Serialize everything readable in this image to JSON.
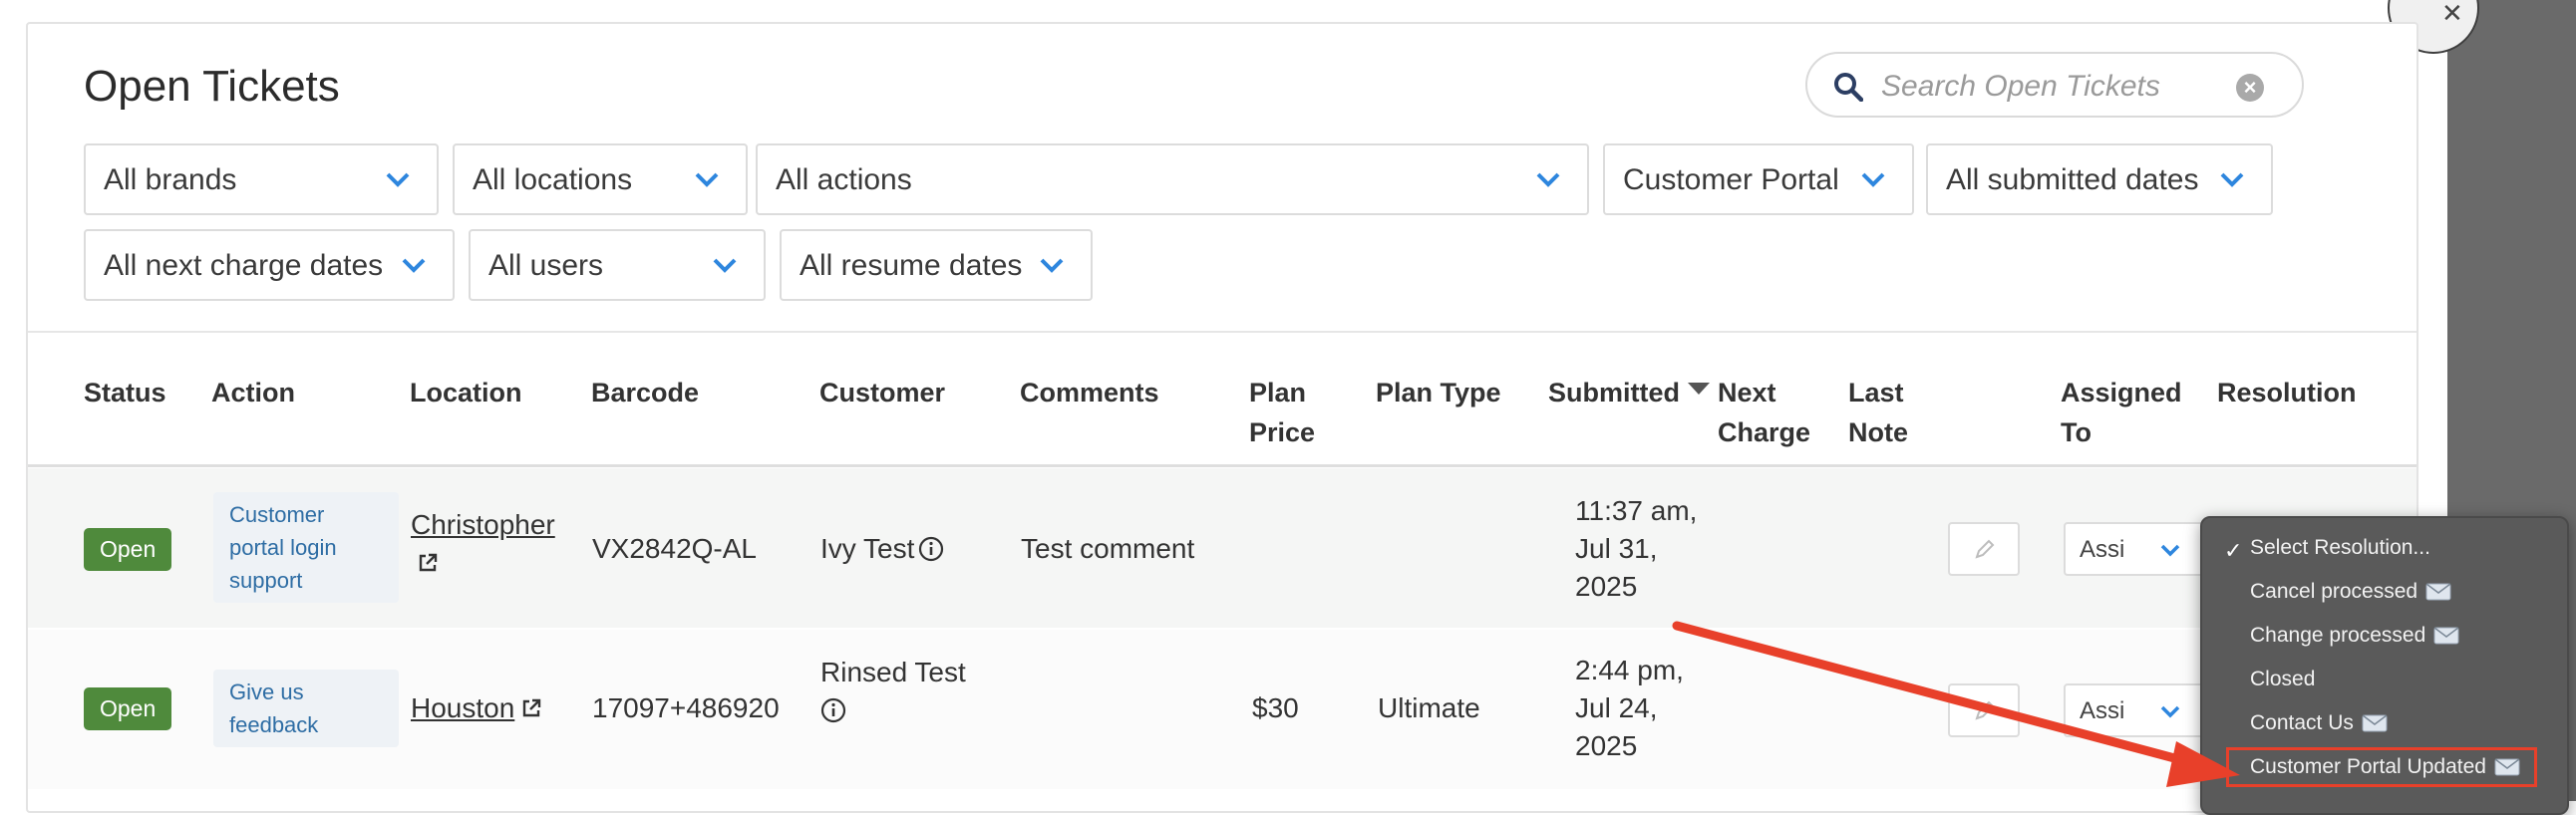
{
  "page": {
    "title": "Open Tickets",
    "search_placeholder": "Search Open Tickets"
  },
  "filters": [
    {
      "label": "All brands"
    },
    {
      "label": "All locations"
    },
    {
      "label": "All actions"
    },
    {
      "label": "Customer Portal"
    },
    {
      "label": "All submitted dates"
    },
    {
      "label": "All next charge dates"
    },
    {
      "label": "All users"
    },
    {
      "label": "All resume dates"
    }
  ],
  "table": {
    "headers": {
      "status": "Status",
      "action": "Action",
      "location": "Location",
      "barcode": "Barcode",
      "customer": "Customer",
      "comments": "Comments",
      "plan_price_1": "Plan",
      "plan_price_2": "Price",
      "plan_type": "Plan Type",
      "submitted": "Submitted",
      "next_charge_1": "Next",
      "next_charge_2": "Charge",
      "last_note_1": "Last",
      "last_note_2": "Note",
      "assigned_1": "Assigned",
      "assigned_2": "To",
      "resolution": "Resolution"
    },
    "rows": [
      {
        "status": "Open",
        "action_1": "Customer",
        "action_2": "portal login",
        "action_3": "support",
        "location": "Christopher",
        "barcode": "VX2842Q-AL",
        "customer": "Ivy Test",
        "comments": "Test comment",
        "plan_price": "",
        "plan_type": "",
        "submitted_1": "11:37 am,",
        "submitted_2": "Jul 31,",
        "submitted_3": "2025",
        "assigned": "Assign"
      },
      {
        "status": "Open",
        "action_1": "Give us",
        "action_2": "feedback",
        "location": "Houston",
        "barcode": "17097+486920",
        "customer_1": "Rinsed Test",
        "comments": "",
        "plan_price": "$30",
        "plan_type": "Ultimate",
        "submitted_1": "2:44 pm,",
        "submitted_2": "Jul 24,",
        "submitted_3": "2025",
        "assigned": "Assign"
      }
    ]
  },
  "resolution_dropdown": {
    "items": [
      {
        "label": "Select Resolution...",
        "selected": true,
        "email_icon": false
      },
      {
        "label": "Cancel processed",
        "email_icon": true
      },
      {
        "label": "Change processed",
        "email_icon": true
      },
      {
        "label": "Closed",
        "email_icon": false
      },
      {
        "label": "Contact Us",
        "email_icon": true
      },
      {
        "label": "Customer Portal Updated",
        "email_icon": true,
        "highlighted": true
      }
    ]
  },
  "colors": {
    "accent_blue": "#2e86de",
    "status_open": "#4f8a3c",
    "annotation_red": "#e8402a",
    "dropdown_bg": "#5a5a5a"
  }
}
